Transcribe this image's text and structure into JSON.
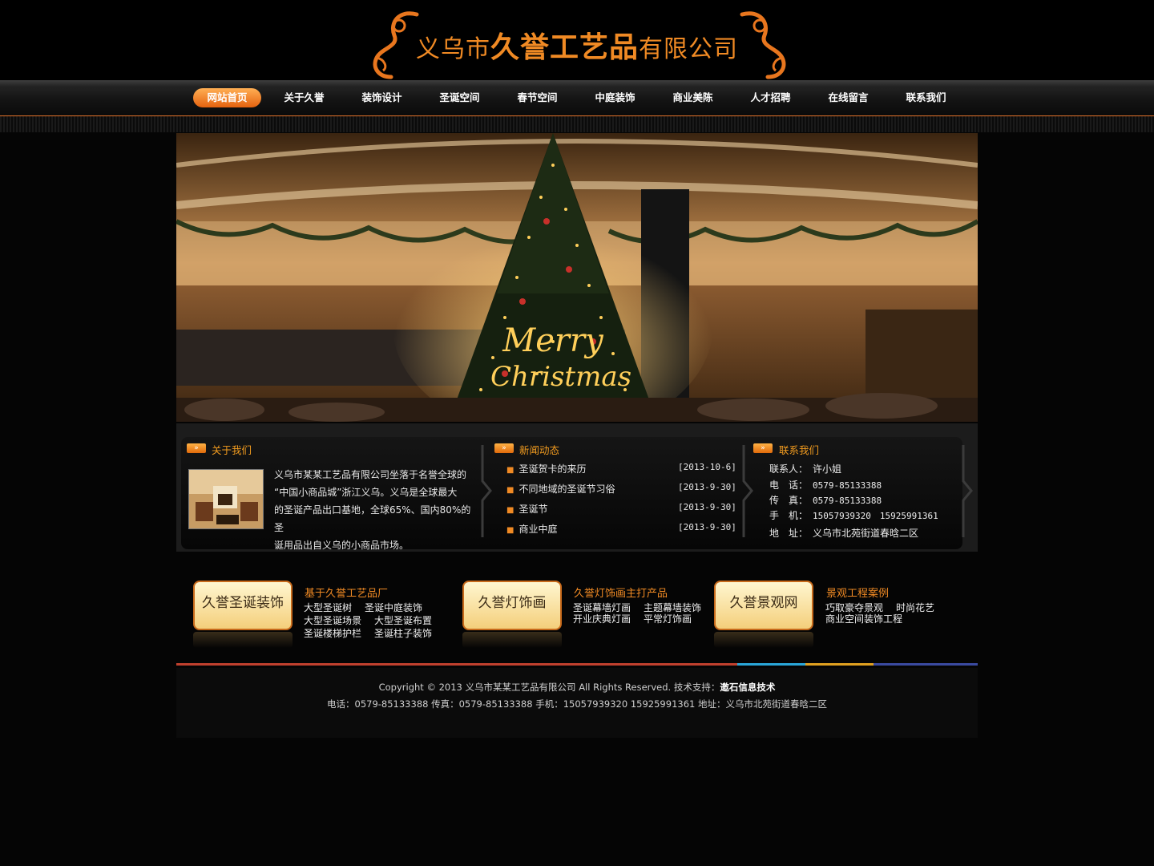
{
  "header": {
    "logo_prefix": "义乌市",
    "logo_main": "久誉工艺品",
    "logo_suffix": "有限公司"
  },
  "nav": [
    {
      "label": "网站首页",
      "active": true
    },
    {
      "label": "关于久誉"
    },
    {
      "label": "装饰设计"
    },
    {
      "label": "圣诞空间"
    },
    {
      "label": "春节空间"
    },
    {
      "label": "中庭装饰"
    },
    {
      "label": "商业美陈"
    },
    {
      "label": "人才招聘"
    },
    {
      "label": "在线留言"
    },
    {
      "label": "联系我们"
    }
  ],
  "banner": {
    "text_line1": "Merry",
    "text_line2": "Christmas"
  },
  "about": {
    "title": "关于我们",
    "lines": [
      "义乌市某某工艺品有限公司坐落于名誉全球的",
      "“中国小商品城”浙江义乌。义乌是全球最大",
      "的圣诞产品出口基地，全球65%、国内80%的圣",
      "诞用品出自义乌的小商品市场。"
    ]
  },
  "news": {
    "title": "新闻动态",
    "items": [
      {
        "title": "圣诞贺卡的来历",
        "date": "[2013-10-6]"
      },
      {
        "title": "不同地域的圣诞节习俗",
        "date": "[2013-9-30]"
      },
      {
        "title": "圣诞节",
        "date": "[2013-9-30]"
      },
      {
        "title": "商业中庭",
        "date": "[2013-9-30]"
      }
    ]
  },
  "contact": {
    "title": "联系我们",
    "rows": [
      {
        "label": "联系人：",
        "value": "许小姐"
      },
      {
        "label": "电　话：",
        "value": "0579-85133388"
      },
      {
        "label": "传　真：",
        "value": "0579-85133388"
      },
      {
        "label": "手　机：",
        "value": "15057939320　15925991361"
      },
      {
        "label": "地　址：",
        "value": "义乌市北苑街道春晗二区"
      }
    ]
  },
  "promos": [
    {
      "button": "久誉圣诞装饰",
      "title": "基于久誉工艺品厂",
      "lines": [
        [
          "大型圣诞树",
          "圣诞中庭装饰"
        ],
        [
          "大型圣诞场景",
          "大型圣诞布置"
        ],
        [
          "圣诞楼梯护栏",
          "圣诞柱子装饰"
        ]
      ]
    },
    {
      "button": "久誉灯饰画",
      "title": "久誉灯饰画主打产品",
      "lines": [
        [
          "圣诞幕墙灯画",
          "主题幕墙装饰"
        ],
        [
          "开业庆典灯画",
          "平常灯饰画"
        ]
      ]
    },
    {
      "button": "久誉景观网",
      "title": "景观工程案例",
      "lines": [
        [
          "巧取豪夺景观",
          "时尚花艺"
        ],
        [
          "商业空间装饰工程"
        ]
      ]
    }
  ],
  "footer": {
    "copyright": "Copyright © 2013 义乌市某某工艺品有限公司  All Rights Reserved.  技术支持：",
    "tech_support": "邀石信息技术",
    "contact_line": "电话：0579-85133388 传真：0579-85133388 手机：15057939320 15925991361 地址：义乌市北苑街道春晗二区"
  },
  "colors": {
    "accent": "#f08a24",
    "background": "#050505",
    "nav_active": "#ef7a1c"
  }
}
